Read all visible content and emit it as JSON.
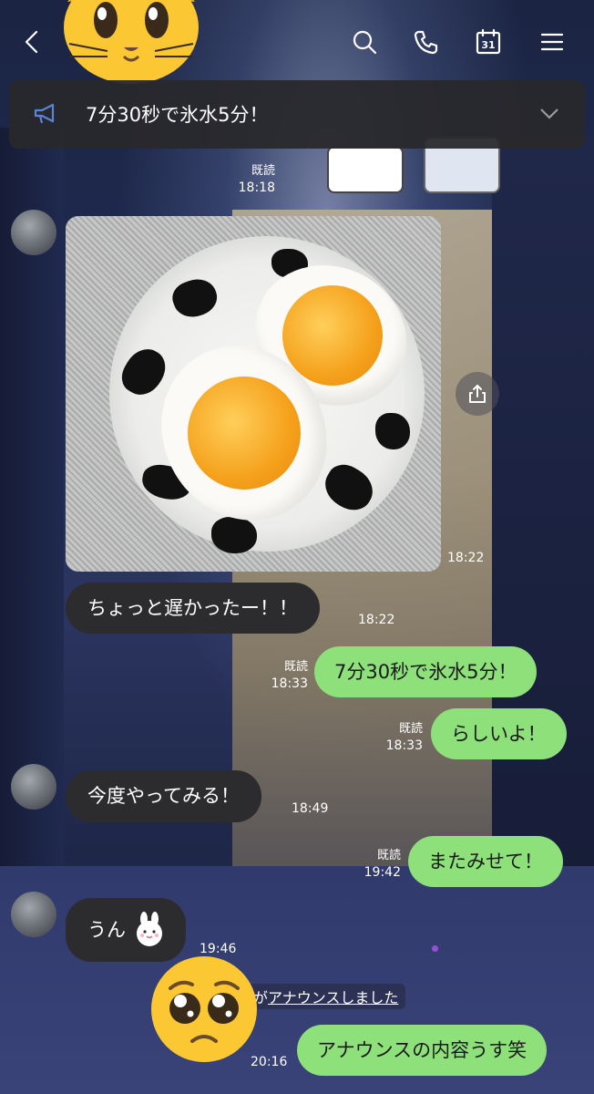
{
  "header": {
    "back_icon": "chevron-left-icon",
    "actions": [
      "search-icon",
      "phone-icon",
      "calendar-icon",
      "menu-icon"
    ],
    "calendar_day": "31"
  },
  "announcement": {
    "icon": "megaphone-icon",
    "text": "7分30秒で氷水5分！",
    "expand_icon": "chevron-down-icon"
  },
  "messages": [
    {
      "side": "out",
      "read": "既読",
      "time": "18:18"
    },
    {
      "side": "in",
      "type": "photo",
      "time": "18:22"
    },
    {
      "side": "in",
      "text": "ちょっと遅かったー！！",
      "time": "18:22"
    },
    {
      "side": "out",
      "text": "7分30秒で氷水5分！",
      "read": "既読",
      "time": "18:33"
    },
    {
      "side": "out",
      "text": "らしいよ！",
      "read": "既読",
      "time": "18:33"
    },
    {
      "side": "in",
      "text": "今度やってみる！",
      "time": "18:49"
    },
    {
      "side": "out",
      "text": "またみせて！",
      "read": "既読",
      "time": "19:42"
    },
    {
      "side": "in",
      "text": "うん",
      "sticker": "rabbit-emoji",
      "time": "19:46"
    },
    {
      "side": "out",
      "text": "アナウンスの内容うす笑",
      "time": "20:16"
    }
  ],
  "system_notice": {
    "prefix": "が",
    "link": "アナウンスしました"
  },
  "emoji": {
    "top": "cat-face-emoji",
    "bottom": "pleading-face-emoji"
  },
  "colors": {
    "outgoing": "#8de07a",
    "incoming": "#2c2c2e",
    "banner": "#28282c"
  }
}
